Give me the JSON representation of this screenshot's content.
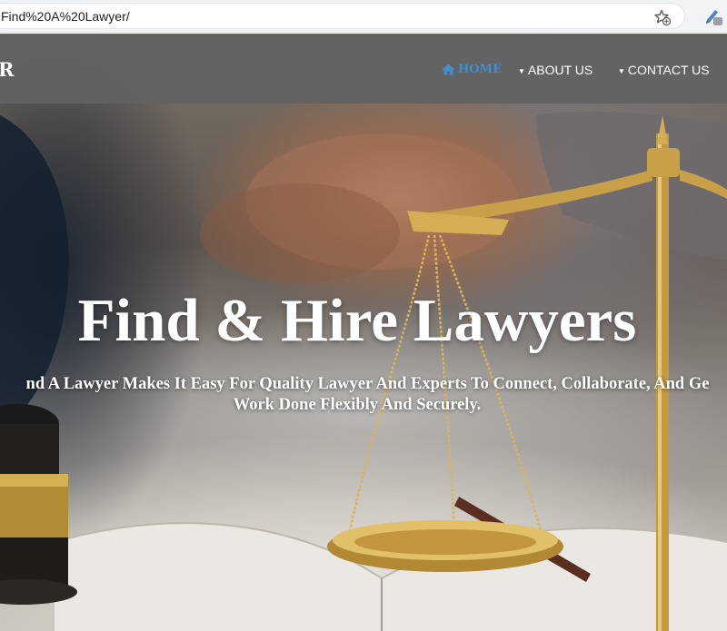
{
  "browser": {
    "url": "Find%20A%20Lawyer/",
    "icons": {
      "bookmark": "star-add-icon",
      "extension": "pen-extension-icon"
    }
  },
  "site": {
    "brand_fragment": "R",
    "nav": {
      "home": "HOME",
      "about": "ABOUT US",
      "contact": "CONTACT US"
    }
  },
  "hero": {
    "title": "Find & Hire Lawyers",
    "subtitle_line1": "nd A Lawyer Makes It Easy For Quality Lawyer And Experts To Connect, Collaborate, And Ge",
    "subtitle_line2": "Work Done Flexibly And Securely."
  },
  "colors": {
    "nav_background": "#626262",
    "nav_active": "#3f8fd6",
    "text": "#ffffff"
  }
}
